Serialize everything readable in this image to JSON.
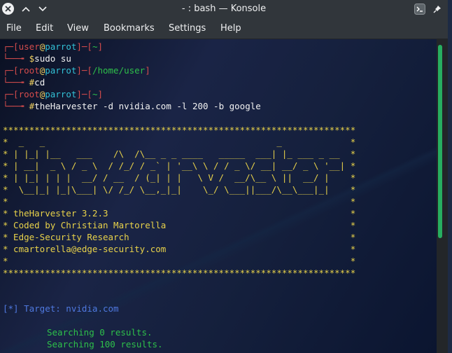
{
  "window": {
    "title": "- : bash — Konsole"
  },
  "menu": [
    "File",
    "Edit",
    "View",
    "Bookmarks",
    "Settings",
    "Help"
  ],
  "prompts": [
    {
      "user": "user",
      "at": "@",
      "host": "parrot",
      "dir": "~",
      "sym": "$",
      "cmd": "sudo su"
    },
    {
      "user": "root",
      "at": "@",
      "host": "parrot",
      "dir": "/home/user",
      "sym": "#",
      "cmd": "cd"
    },
    {
      "user": "root",
      "at": "@",
      "host": "parrot",
      "dir": "~",
      "sym": "#",
      "cmd": "theHarvester -d nvidia.com -l 200 -b google"
    }
  ],
  "banner": [
    "*******************************************************************",
    "*  _   _                                            _             *",
    "* | |_| |__   ___    /\\  /\\__ _ _ ____   _____  ___| |_ ___ _ __  *",
    "* | __|  _ \\ / _ \\  / /_/ / _` | '__\\ \\ / / _ \\/ __| __/ _ \\ '__| *",
    "* | |_| | | |  __/ / __  / (_| | |   \\ V /  __/\\__ \\ ||  __/ |    *",
    "*  \\__|_| |_|\\___| \\/ /_/ \\__,_|_|    \\_/ \\___||___/\\__\\___|_|    *",
    "*                                                                 *",
    "* theHarvester 3.2.3                                              *",
    "* Coded by Christian Martorella                                   *",
    "* Edge-Security Research                                          *",
    "* cmartorella@edge-security.com                                   *",
    "*                                                                 *",
    "*******************************************************************"
  ],
  "target": "[*] Target: nvidia.com",
  "results": [
    "Searching 0 results.",
    "Searching 100 results."
  ]
}
